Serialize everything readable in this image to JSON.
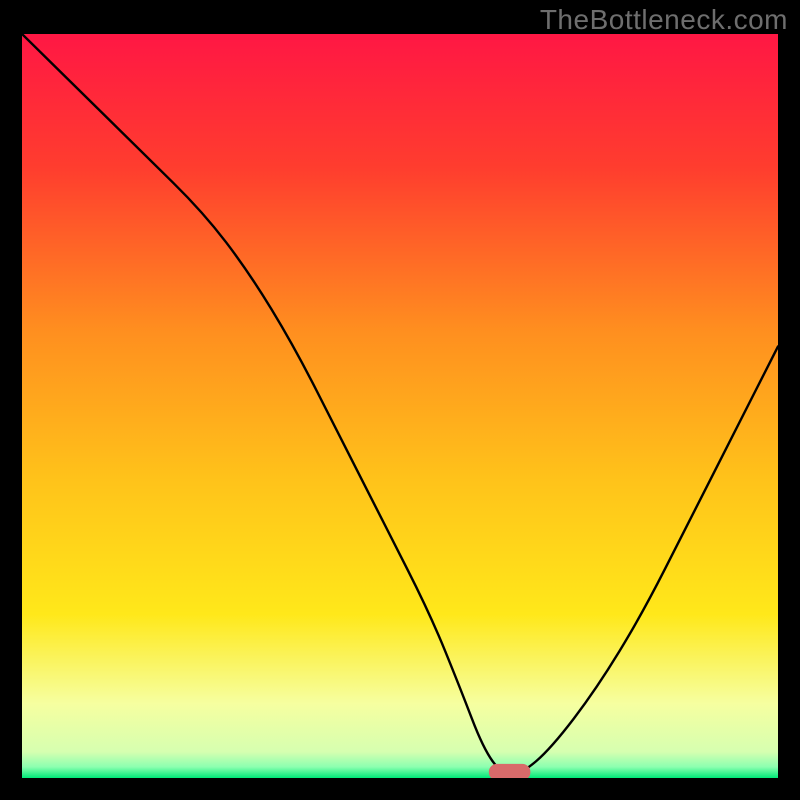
{
  "watermark": "TheBottleneck.com",
  "chart_data": {
    "type": "line",
    "title": "",
    "xlabel": "",
    "ylabel": "",
    "xlim": [
      0,
      100
    ],
    "ylim": [
      0,
      100
    ],
    "gradient_stops": [
      {
        "offset": 0,
        "color": "#ff1744"
      },
      {
        "offset": 0.18,
        "color": "#ff3d2e"
      },
      {
        "offset": 0.4,
        "color": "#ff8f1f"
      },
      {
        "offset": 0.6,
        "color": "#ffc31a"
      },
      {
        "offset": 0.78,
        "color": "#ffe81a"
      },
      {
        "offset": 0.9,
        "color": "#f6ffa0"
      },
      {
        "offset": 0.965,
        "color": "#d6ffb0"
      },
      {
        "offset": 0.985,
        "color": "#8cffb0"
      },
      {
        "offset": 1.0,
        "color": "#00e878"
      }
    ],
    "series": [
      {
        "name": "bottleneck-curve",
        "x": [
          0,
          8,
          16,
          24,
          30,
          36,
          42,
          48,
          54,
          58,
          61,
          63.5,
          66,
          70,
          76,
          82,
          88,
          94,
          100
        ],
        "y": [
          100,
          92,
          84,
          76,
          68,
          58,
          46,
          34,
          22,
          12,
          4,
          0.5,
          0.5,
          4,
          12,
          22,
          34,
          46,
          58
        ]
      }
    ],
    "marker": {
      "name": "optimal-point",
      "x": 64.5,
      "y": 0.8,
      "width": 5.5,
      "height": 2.2,
      "color": "#d86a6a"
    }
  }
}
